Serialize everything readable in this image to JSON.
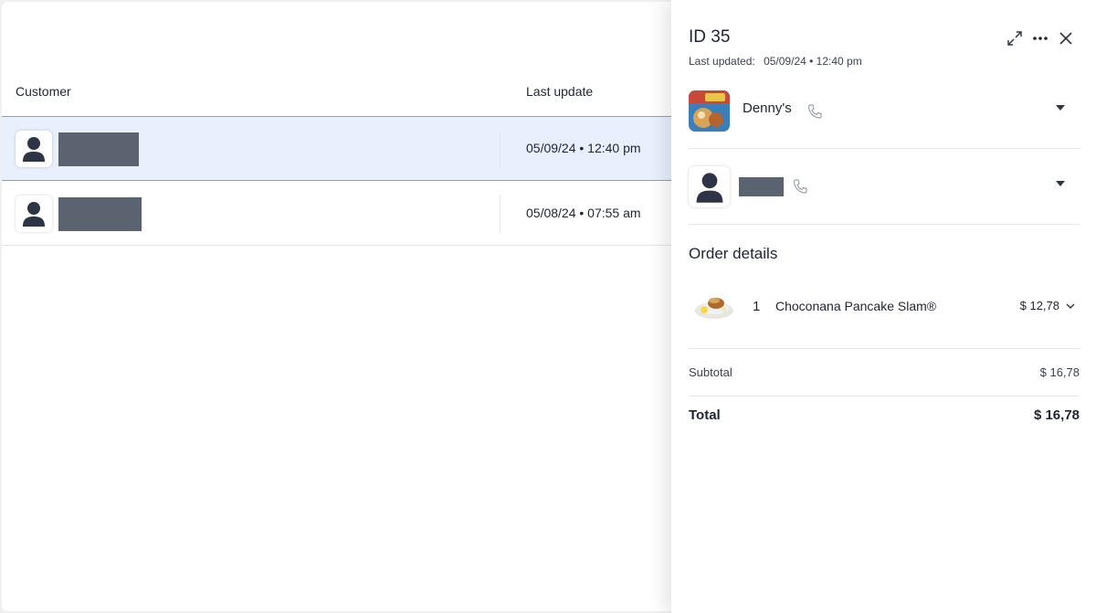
{
  "table": {
    "headers": {
      "customer": "Customer",
      "last_update": "Last update"
    },
    "rows": [
      {
        "date": "05/09/24 • 12:40 pm",
        "selected": true
      },
      {
        "date": "05/08/24 • 07:55 am",
        "selected": false
      }
    ]
  },
  "panel": {
    "title": "ID 35",
    "updated_label": "Last updated:",
    "updated_value": "05/09/24 • 12:40 pm",
    "restaurant": {
      "name": "Denny's"
    },
    "order_details_title": "Order details",
    "items": [
      {
        "qty": "1",
        "name": "Choconana Pancake Slam®",
        "price": "$ 12,78"
      }
    ],
    "subtotal_label": "Subtotal",
    "subtotal_value": "$ 16,78",
    "total_label": "Total",
    "total_value": "$ 16,78"
  },
  "icons": {
    "expand": "expand-icon",
    "more": "more-horizontal-icon",
    "close": "close-icon",
    "phone": "phone-icon",
    "caret": "caret-down-icon",
    "chevron": "chevron-down-icon",
    "avatar": "person-icon"
  },
  "colors": {
    "selected_row": "#e8f0fd",
    "selected_border": "#8aa0c8",
    "redaction": "#5b6270",
    "text": "#1d2433"
  }
}
